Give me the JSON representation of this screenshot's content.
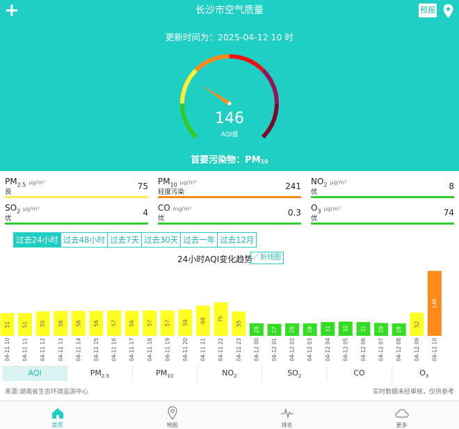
{
  "header": {
    "title": "长沙市空气质量",
    "forecast_button": "预报"
  },
  "hero": {
    "updated_text": "更新时间为：2025-04-12 10 时",
    "aqi_value": 146,
    "aqi_label": "AQI值",
    "gauge_fraction": 0.29,
    "primary_label": "首要污染物：PM",
    "primary_sub": "10"
  },
  "pollutants": [
    {
      "name": "PM",
      "sub": "2.5",
      "unit": "μg/m³",
      "level": "良",
      "value": "75",
      "color": "#ffee55"
    },
    {
      "name": "PM",
      "sub": "10",
      "unit": "μg/m³",
      "level": "轻度污染",
      "value": "241",
      "color": "#ff8a1a"
    },
    {
      "name": "NO",
      "sub": "2",
      "unit": "μg/m³",
      "level": "优",
      "value": "8",
      "color": "#33cc33"
    },
    {
      "name": "SO",
      "sub": "2",
      "unit": "μg/m³",
      "level": "优",
      "value": "4",
      "color": "#33cc33"
    },
    {
      "name": "CO",
      "sub": "",
      "unit": "mg/m³",
      "level": "优",
      "value": "0.3",
      "color": "#33cc33"
    },
    {
      "name": "O",
      "sub": "3",
      "unit": "μg/m³",
      "level": "优",
      "value": "74",
      "color": "#33cc33"
    }
  ],
  "range_tabs": [
    "过去24小时",
    "过去48小时",
    "过去7天",
    "过去30天",
    "过去一年",
    "过去12月"
  ],
  "range_active": 0,
  "trend_title": "24小时AQI变化趋势",
  "line_view_label": "折线图",
  "chart_data": {
    "type": "bar",
    "categories": [
      "04-11 10",
      "04-11 11",
      "04-11 12",
      "04-11 13",
      "04-11 14",
      "04-11 15",
      "04-11 16",
      "04-11 17",
      "04-11 18",
      "04-11 19",
      "04-11 20",
      "04-11 21",
      "04-11 22",
      "04-11 23",
      "04-12 00",
      "04-12 01",
      "04-12 02",
      "04-12 03",
      "04-12 04",
      "04-12 05",
      "04-12 06",
      "04-12 07",
      "04-12 08",
      "04-12 09",
      "04-12 10"
    ],
    "values": [
      51,
      51,
      55,
      56,
      56,
      56,
      57,
      56,
      57,
      57,
      59,
      68,
      75,
      55,
      28,
      27,
      28,
      28,
      31,
      32,
      31,
      29,
      28,
      52,
      146
    ],
    "colors": {
      "good": "#33dd22",
      "moderate": "#ffff22",
      "light": "#ff8a1a"
    },
    "ylim": [
      0,
      150
    ]
  },
  "pollutant_tabs": [
    {
      "label": "AQI",
      "sub": ""
    },
    {
      "label": "PM",
      "sub": "2.5"
    },
    {
      "label": "PM",
      "sub": "10"
    },
    {
      "label": "NO",
      "sub": "2"
    },
    {
      "label": "SO",
      "sub": "2"
    },
    {
      "label": "CO",
      "sub": ""
    },
    {
      "label": "O",
      "sub": "3"
    }
  ],
  "pollutant_active": 0,
  "footer": {
    "source": "来源:湖南省生态环境监测中心",
    "disclaimer": "实时数据未经审核，仅供参考"
  },
  "nav": [
    {
      "label": "首页",
      "icon": "home-icon"
    },
    {
      "label": "地图",
      "icon": "map-pin-icon"
    },
    {
      "label": "排名",
      "icon": "pulse-icon"
    },
    {
      "label": "更多",
      "icon": "cloud-icon"
    }
  ],
  "nav_active": 0
}
